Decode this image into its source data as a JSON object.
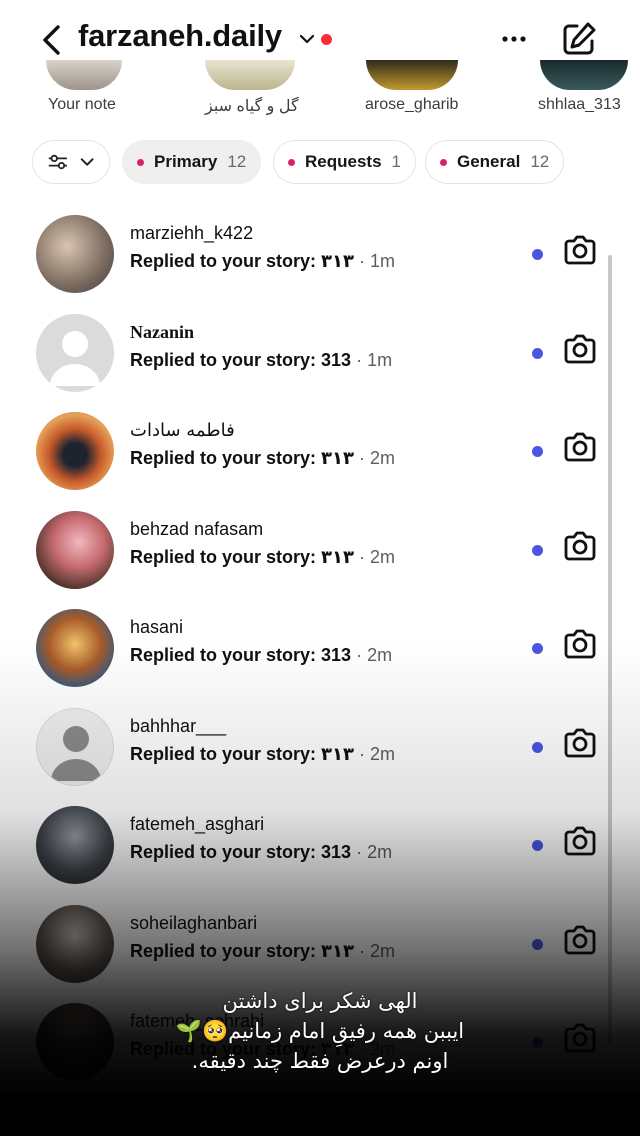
{
  "header": {
    "title": "farzaneh.daily"
  },
  "notes": [
    {
      "label": "Your note"
    },
    {
      "label": "گل و گیاه سبز"
    },
    {
      "label": "arose_gharib"
    },
    {
      "label": "shhlaa_313"
    }
  ],
  "filters": {
    "primary": {
      "label": "Primary",
      "count": "12"
    },
    "requests": {
      "label": "Requests",
      "count": "1"
    },
    "general": {
      "label": "General",
      "count": "12"
    }
  },
  "threads": [
    {
      "name": "marziehh_k422",
      "message": "Replied to your story: ۳۱۳",
      "sep": " · ",
      "time": "1m"
    },
    {
      "name": "Nazanin",
      "message": "Replied to your story: 313",
      "sep": " · ",
      "time": "1m"
    },
    {
      "name": "فاطمه سادات",
      "message": "Replied to your story: ۳۱۳",
      "sep": " · ",
      "time": "2m"
    },
    {
      "name": "behzad nafasam",
      "message": "Replied to your story: ۳۱۳",
      "sep": " · ",
      "time": "2m"
    },
    {
      "name": "hasani",
      "message": "Replied to your story: 313",
      "sep": " · ",
      "time": "2m"
    },
    {
      "name": "bahhhar___",
      "message": "Replied to your story: ۳۱۳",
      "sep": " · ",
      "time": "2m"
    },
    {
      "name": "fatemeh_asghari",
      "message": "Replied to your story: 313",
      "sep": " · ",
      "time": "2m"
    },
    {
      "name": "soheilaghanbari",
      "message": "Replied to your story: ۳۱۳",
      "sep": " · ",
      "time": "2m"
    },
    {
      "name": "fatemeh_sohrabi",
      "message": "Replied to your story: ۳۱۳",
      "sep": " · ",
      "time": "2m"
    }
  ],
  "caption": {
    "line1": "الهی شکر برای داشتن",
    "line2": "ایببن همه رفیقِ امام زمانیم🥺🌱",
    "line3": "اونم درعرض  فقط چند دقیقه."
  },
  "colors": {
    "unread": "#4a56e2",
    "notification_dot": "#ff2b3b",
    "filter_dot": "#d6206b"
  }
}
